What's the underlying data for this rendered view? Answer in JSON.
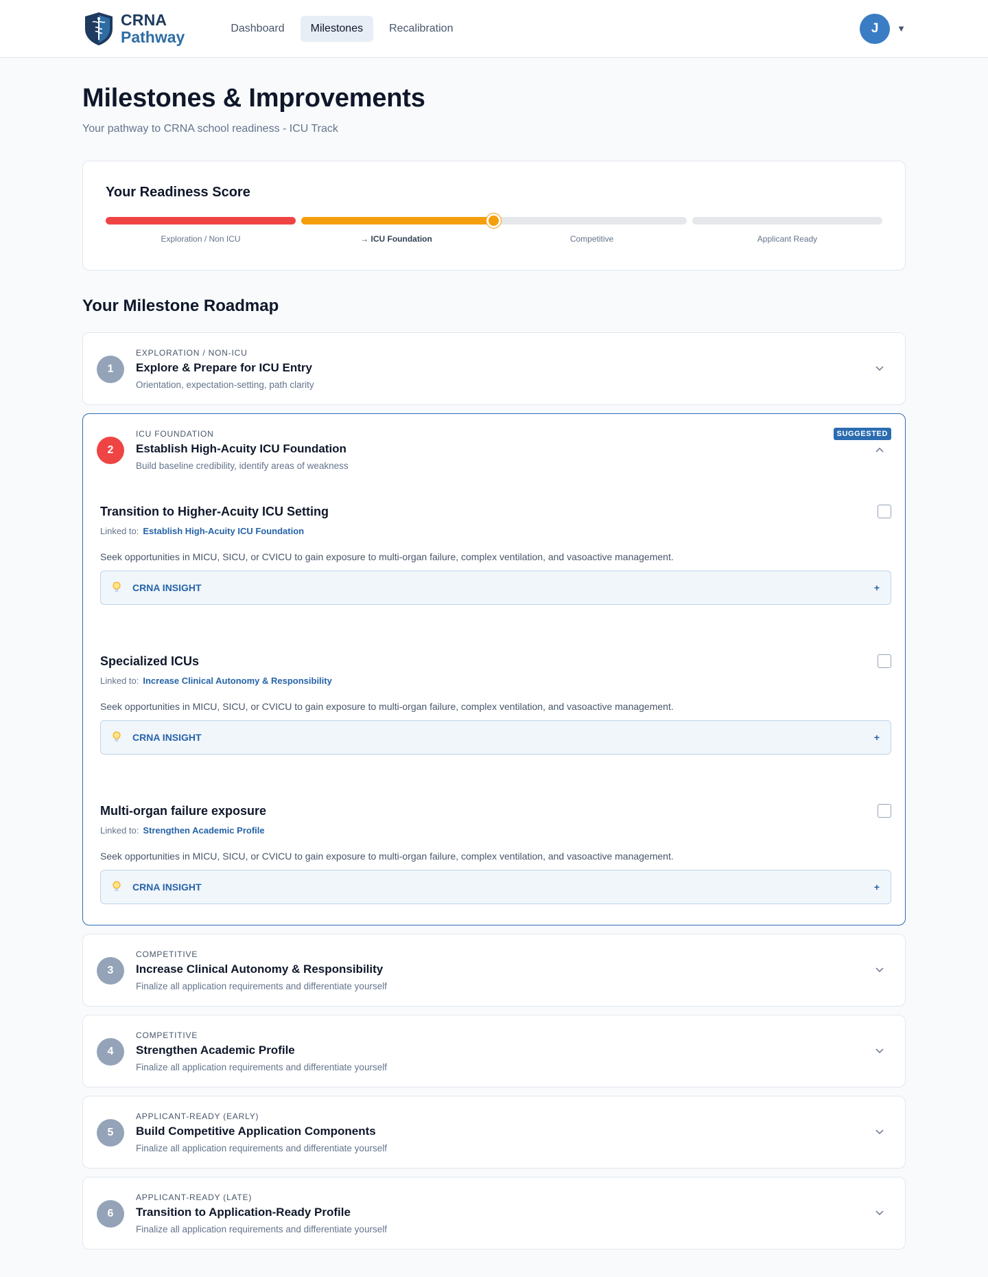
{
  "brand": {
    "line1": "CRNA",
    "line2": "Pathway"
  },
  "nav": [
    {
      "label": "Dashboard",
      "active": false
    },
    {
      "label": "Milestones",
      "active": true
    },
    {
      "label": "Recalibration",
      "active": false
    }
  ],
  "user": {
    "initial": "J"
  },
  "page": {
    "title": "Milestones & Improvements",
    "subtitle": "Your pathway to CRNA school readiness - ICU Track"
  },
  "readiness": {
    "title": "Your Readiness Score",
    "stages": [
      {
        "label": "Exploration / Non ICU",
        "color": "#ef4444",
        "filled": true
      },
      {
        "label": "→ ICU Foundation",
        "color": "#f59e0b",
        "filled": true,
        "current": true
      },
      {
        "label": "Competitive",
        "color": "#e5e7eb",
        "filled": false
      },
      {
        "label": "Applicant Ready",
        "color": "#e5e7eb",
        "filled": false
      }
    ],
    "marker_position": 0.5
  },
  "roadmap": {
    "title": "Your Milestone Roadmap",
    "milestones": [
      {
        "num": "1",
        "tag": "EXPLORATION / NON-ICU",
        "title": "Explore & Prepare for ICU Entry",
        "desc": "Orientation, expectation-setting, path clarity",
        "expanded": false
      },
      {
        "num": "2",
        "tag": "ICU FOUNDATION",
        "title": "Establish High-Acuity ICU Foundation",
        "desc": "Build baseline credibility, identify areas of weakness",
        "expanded": true,
        "badge": "SUGGESTED",
        "tasks": [
          {
            "title": "Transition to Higher-Acuity ICU Setting",
            "linked_label": "Linked to:",
            "linked": "Establish High-Acuity ICU Foundation",
            "desc": "Seek opportunities in MICU, SICU, or CVICU to gain exposure to multi-organ failure, complex ventilation, and vasoactive management.",
            "insight": "CRNA INSIGHT",
            "plus": "+"
          },
          {
            "title": "Specialized ICUs",
            "linked_label": "Linked to:",
            "linked": "Increase Clinical Autonomy & Responsibility",
            "desc": "Seek opportunities in MICU, SICU, or CVICU to gain exposure to multi-organ failure, complex ventilation, and vasoactive management.",
            "insight": "CRNA INSIGHT",
            "plus": "+"
          },
          {
            "title": "Multi-organ failure exposure",
            "linked_label": "Linked to:",
            "linked": "Strengthen Academic Profile",
            "desc": "Seek opportunities in MICU, SICU, or CVICU to gain exposure to multi-organ failure, complex ventilation, and vasoactive management.",
            "insight": "CRNA INSIGHT",
            "plus": "+"
          }
        ]
      },
      {
        "num": "3",
        "tag": "COMPETITIVE",
        "title": "Increase Clinical Autonomy & Responsibility",
        "desc": "Finalize all application requirements and differentiate yourself",
        "expanded": false
      },
      {
        "num": "4",
        "tag": "COMPETITIVE",
        "title": "Strengthen Academic Profile",
        "desc": "Finalize all application requirements and differentiate yourself",
        "expanded": false
      },
      {
        "num": "5",
        "tag": "APPLICANT-READY (EARLY)",
        "title": "Build Competitive Application Components",
        "desc": "Finalize all application requirements and differentiate yourself",
        "expanded": false
      },
      {
        "num": "6",
        "tag": "APPLICANT-READY (LATE)",
        "title": "Transition to Application-Ready Profile",
        "desc": "Finalize all application requirements and differentiate yourself",
        "expanded": false
      }
    ]
  },
  "icons": {
    "logo": "caduceus-shield-icon",
    "chevron_down": "chevron-down-icon",
    "chevron_up": "chevron-up-icon",
    "bulb": "lightbulb-icon",
    "caret": "caret-down-icon"
  },
  "colors": {
    "accent": "#2b6cb0",
    "danger": "#ef4444",
    "warning": "#f59e0b",
    "muted_badge": "#94a3b8"
  }
}
